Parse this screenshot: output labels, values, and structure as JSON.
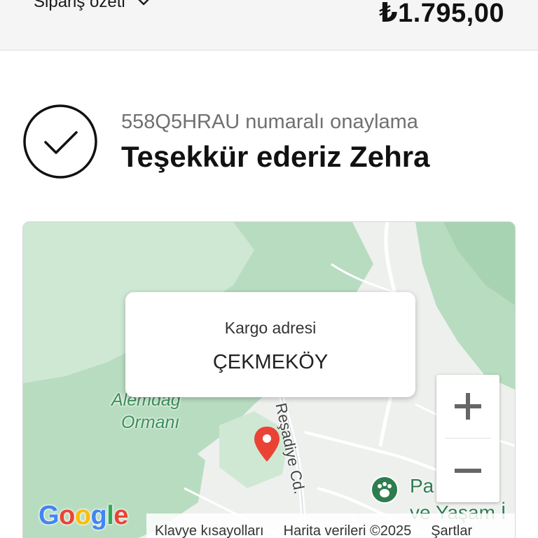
{
  "summary": {
    "toggle_label": "Sipariş özeti",
    "total": "₺1.795,00"
  },
  "confirmation": {
    "subtitle": "558Q5HRAU numaralı onaylama",
    "title": "Teşekkür ederiz Zehra"
  },
  "map": {
    "popup": {
      "label": "Kargo adresi",
      "value": "ÇEKMEKÖY"
    },
    "labels": {
      "forest_line1": "Alemdağ",
      "forest_line2": "Ormanı",
      "road": "Reşadiye Cd.",
      "park_line1": "Park ve Yaşam",
      "park_line2": "ve Yaşam"
    },
    "attribution": {
      "shortcuts": "Klavye kısayolları",
      "data": "Harita verileri ©2025",
      "terms": "Şartlar"
    },
    "logo_text": "Google",
    "zoom_in_icon": "plus-icon",
    "zoom_out_icon": "minus-icon",
    "colors": {
      "forest": "#b8dcc0",
      "forest_light": "#cfe8d4",
      "land": "#eef0ee",
      "pin": "#ea4335",
      "park": "#2e7d4f"
    }
  }
}
